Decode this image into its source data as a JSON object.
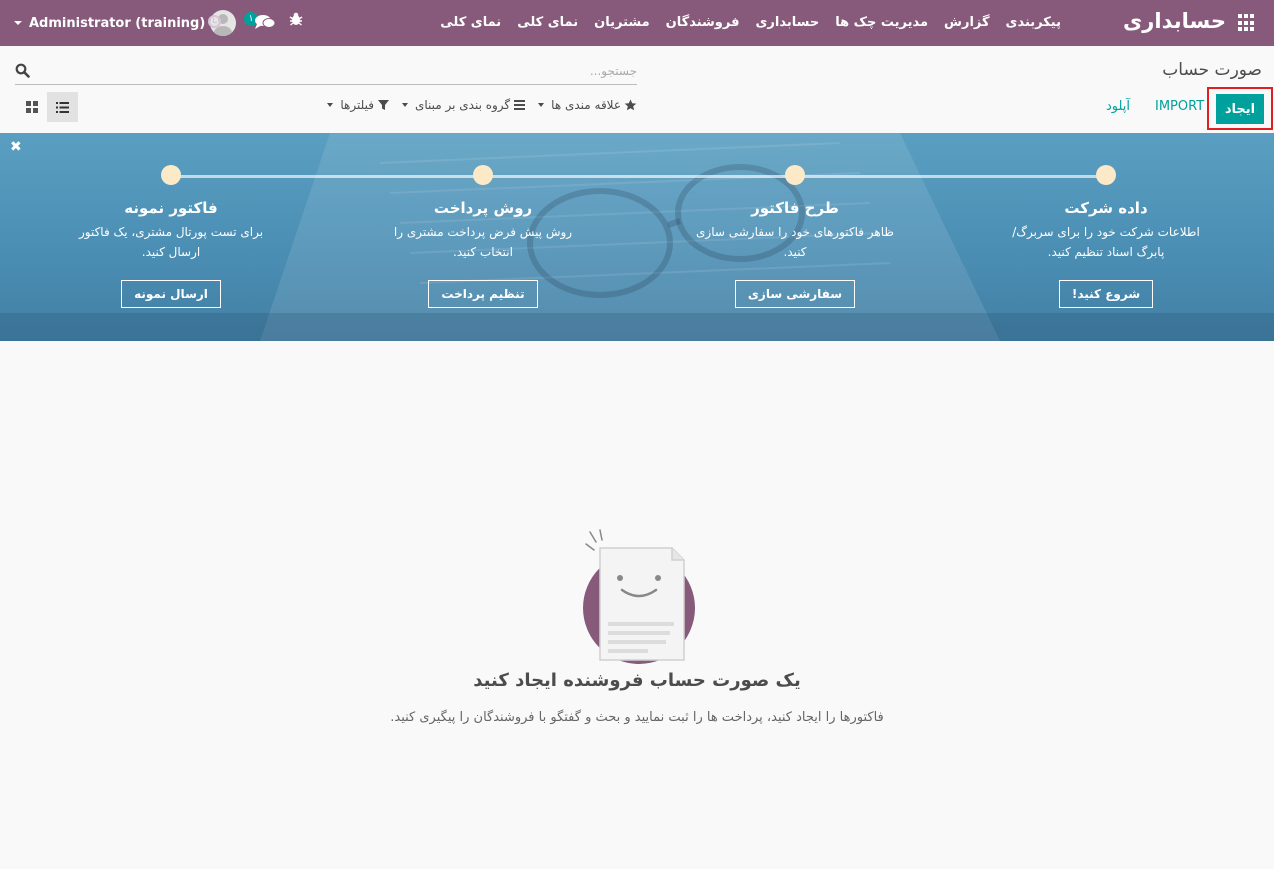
{
  "navbar": {
    "brand": "حسابداری",
    "menu": [
      "نمای کلی",
      "نمای کلی",
      "مشتریان",
      "فروشندگان",
      "حسابداری",
      "مدیریت چک ها",
      "گزارش",
      "پیکربندی"
    ],
    "user_name": "Administrator (training)",
    "chat_count": "۱",
    "bg_color": "#875a7b"
  },
  "control_panel": {
    "title": "صورت حساب",
    "search_placeholder": "جستجو...",
    "create_label": "ایجاد",
    "import_label": "IMPORT",
    "upload_label": "آپلود",
    "filters_label": "فیلترها",
    "group_by_label": "گروه بندی بر مبنای",
    "favorites_label": "علاقه مندی ها",
    "accent_color": "#00a09d"
  },
  "banner": {
    "steps": [
      {
        "title": "داده شرکت",
        "desc": "اطلاعات شرکت خود را برای سربرگ/پابرگ اسناد تنظیم کنید.",
        "button": "شروع کنید!"
      },
      {
        "title": "طرح فاکتور",
        "desc": "ظاهر فاکتورهای خود را سفارشی سازی کنید.",
        "button": "سفارشی سازی"
      },
      {
        "title": "روش پرداخت",
        "desc": "روش پیش فرض پرداخت مشتری را انتخاب کنید.",
        "button": "تنظیم پرداخت"
      },
      {
        "title": "فاکتور نمونه",
        "desc": "برای تست پورتال مشتری، یک فاکتور ارسال کنید.",
        "button": "ارسال نمونه"
      }
    ]
  },
  "empty_state": {
    "title": "یک صورت حساب فروشنده ایجاد کنید",
    "description": "فاکتورها را ایجاد کنید، پرداخت ها را ثبت نمایید و بحث و گفتگو با فروشندگان را پیگیری کنید."
  }
}
